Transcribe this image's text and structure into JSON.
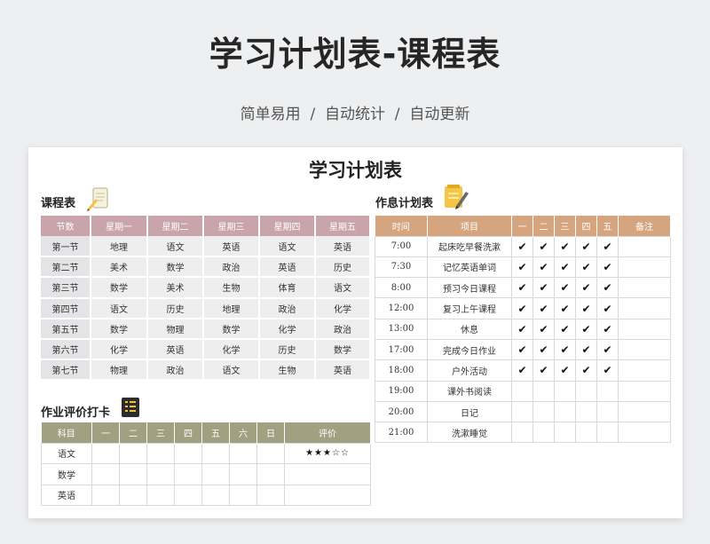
{
  "header": {
    "title": "学习计划表-课程表",
    "subtitle": "简单易用  /  自动统计  /  自动更新"
  },
  "sheet": {
    "title": "学习计划表"
  },
  "course": {
    "title": "课程表",
    "headers": [
      "节数",
      "星期一",
      "星期二",
      "星期三",
      "星期四",
      "星期五"
    ],
    "rows": [
      [
        "第一节",
        "地理",
        "语文",
        "英语",
        "语文",
        "英语"
      ],
      [
        "第二节",
        "美术",
        "数学",
        "政治",
        "英语",
        "历史"
      ],
      [
        "第三节",
        "数学",
        "美术",
        "生物",
        "体育",
        "语文"
      ],
      [
        "第四节",
        "语文",
        "历史",
        "地理",
        "政治",
        "化学"
      ],
      [
        "第五节",
        "数学",
        "物理",
        "数学",
        "化学",
        "政治"
      ],
      [
        "第六节",
        "化学",
        "英语",
        "化学",
        "历史",
        "数学"
      ],
      [
        "第七节",
        "物理",
        "政治",
        "语文",
        "生物",
        "英语"
      ]
    ]
  },
  "homework": {
    "title": "作业评价打卡",
    "headers": [
      "科目",
      "一",
      "二",
      "三",
      "四",
      "五",
      "六",
      "日",
      "评价"
    ],
    "rows": [
      [
        "语文",
        "",
        "",
        "",
        "",
        "",
        "",
        "",
        "★★★☆☆"
      ],
      [
        "数学",
        "",
        "",
        "",
        "",
        "",
        "",
        "",
        ""
      ],
      [
        "英语",
        "",
        "",
        "",
        "",
        "",
        "",
        "",
        ""
      ]
    ]
  },
  "rest": {
    "title": "作息计划表",
    "headers": [
      "时间",
      "项目",
      "一",
      "二",
      "三",
      "四",
      "五",
      "备注"
    ],
    "rows": [
      [
        "7:00",
        "起床吃早餐洗漱",
        "✔",
        "✔",
        "✔",
        "✔",
        "✔",
        ""
      ],
      [
        "7:30",
        "记忆英语单词",
        "✔",
        "✔",
        "✔",
        "✔",
        "✔",
        ""
      ],
      [
        "8:00",
        "预习今日课程",
        "✔",
        "✔",
        "✔",
        "✔",
        "✔",
        ""
      ],
      [
        "12:00",
        "复习上午课程",
        "✔",
        "✔",
        "✔",
        "✔",
        "✔",
        ""
      ],
      [
        "13:00",
        "休息",
        "✔",
        "✔",
        "✔",
        "✔",
        "✔",
        ""
      ],
      [
        "17:00",
        "完成今日作业",
        "✔",
        "✔",
        "✔",
        "✔",
        "✔",
        ""
      ],
      [
        "18:00",
        "户外活动",
        "✔",
        "✔",
        "✔",
        "✔",
        "✔",
        ""
      ],
      [
        "19:00",
        "课外书阅读",
        "",
        "",
        "",
        "",
        "",
        ""
      ],
      [
        "20:00",
        "日记",
        "",
        "",
        "",
        "",
        "",
        ""
      ],
      [
        "21:00",
        "洗漱睡觉",
        "",
        "",
        "",
        "",
        "",
        ""
      ]
    ]
  },
  "icons": {
    "course_icon": "notebook-pencil-icon",
    "rest_icon": "memo-pencil-icon",
    "homework_icon": "checklist-icon"
  },
  "colors": {
    "course_header": "#c9a4ab",
    "rest_header": "#d4a57f",
    "homework_header": "#a1a080"
  }
}
